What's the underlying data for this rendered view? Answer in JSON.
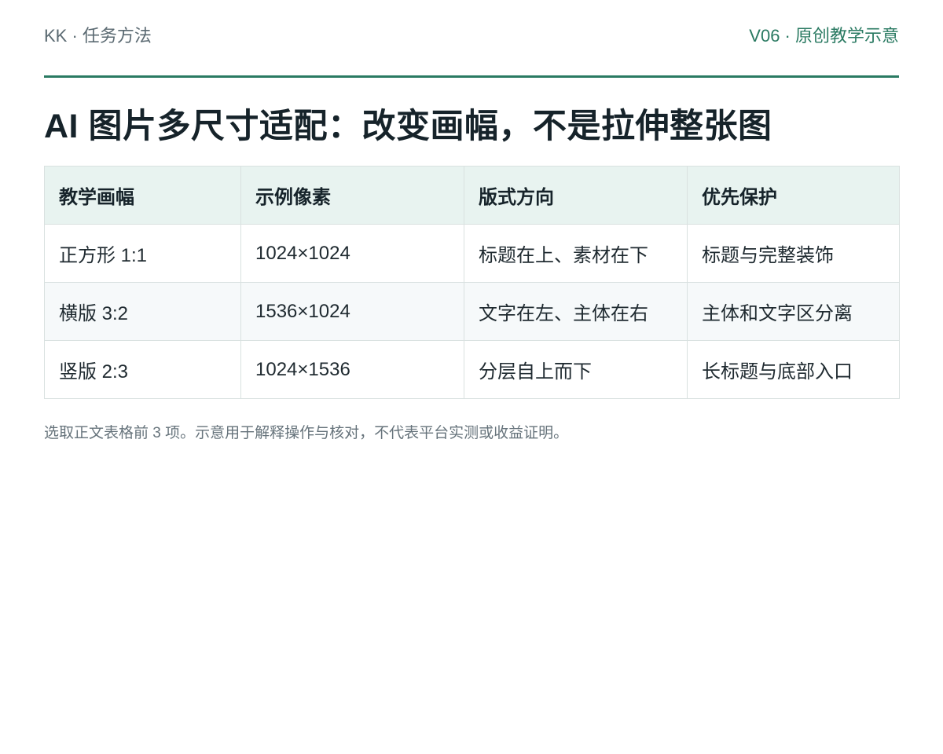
{
  "header": {
    "left": "KK · 任务方法",
    "right": "V06 · 原创教学示意"
  },
  "title": "AI 图片多尺寸适配：改变画幅，不是拉伸整张图",
  "table": {
    "headers": [
      "教学画幅",
      "示例像素",
      "版式方向",
      "优先保护"
    ],
    "rows": [
      [
        "正方形 1:1",
        "1024×1024",
        "标题在上、素材在下",
        "标题与完整装饰"
      ],
      [
        "横版 3:2",
        "1536×1024",
        "文字在左、主体在右",
        "主体和文字区分离"
      ],
      [
        "竖版 2:3",
        "1024×1536",
        "分层自上而下",
        "长标题与底部入口"
      ]
    ]
  },
  "note": "选取正文表格前 3 项。示意用于解释操作与核对，不代表平台实测或收益证明。",
  "colors": {
    "accent": "#2a7a62",
    "header_fill": "#e8f3f0",
    "stripe_fill": "#f6f9fa"
  }
}
